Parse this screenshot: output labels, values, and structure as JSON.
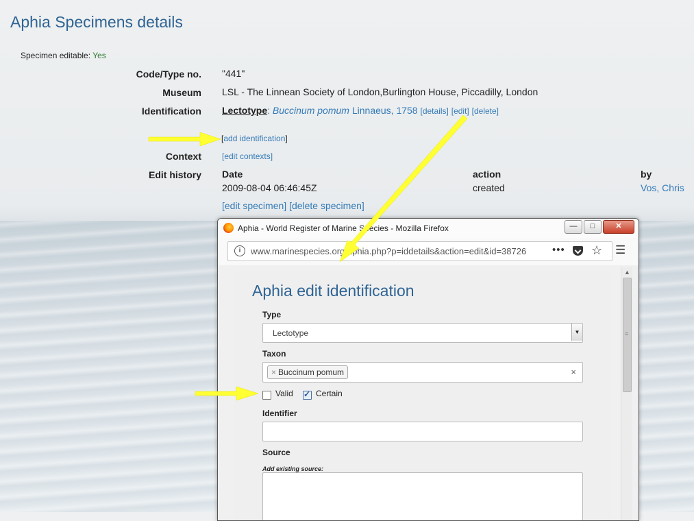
{
  "page": {
    "title": "Aphia Specimens details",
    "editable_label": "Specimen editable:",
    "editable_value": "Yes"
  },
  "details": {
    "code_label": "Code/Type no.",
    "code_value": "\"441\"",
    "museum_label": "Museum",
    "museum_value": "LSL - The Linnean Society of London,Burlington House, Piccadilly, London",
    "identification_label": "Identification",
    "identification_type": "Lectotype",
    "identification_sep": ":",
    "identification_taxon": "Buccinum pomum",
    "identification_author": "Linnaeus, 1758",
    "details_link": "[details]",
    "edit_link": "[edit]",
    "delete_link": "[delete]",
    "add_identification": "add identification",
    "context_label": "Context",
    "edit_contexts": "[edit contexts]",
    "edit_history_label": "Edit history",
    "history_headers": {
      "date": "Date",
      "action": "action",
      "by": "by"
    },
    "history_row": {
      "date": "2009-08-04 06:46:45Z",
      "action": "created",
      "by": "Vos, Chris"
    },
    "edit_specimen": "[edit specimen]",
    "delete_specimen": "[delete specimen]"
  },
  "firefox": {
    "window_title": "Aphia - World Register of Marine Species - Mozilla Firefox",
    "minimize": "—",
    "maximize": "□",
    "close": "✕",
    "url": "www.marinespecies.org/aphia.php?p=iddetails&action=edit&id=38726",
    "url_menu": "•••"
  },
  "edit_form": {
    "title": "Aphia edit identification",
    "type_label": "Type",
    "type_value": "Lectotype",
    "taxon_label": "Taxon",
    "taxon_tag": "Buccinum pomum",
    "taxon_tag_remove": "×",
    "taxon_clear": "×",
    "valid_label": "Valid",
    "valid_checked": false,
    "certain_label": "Certain",
    "certain_checked": true,
    "identifier_label": "Identifier",
    "identifier_value": "",
    "source_label": "Source",
    "source_hint": "Add existing source:"
  },
  "colors": {
    "title_blue": "#2f6494",
    "link_blue": "#337ab7",
    "annotation_arrow": "#ffff33"
  }
}
